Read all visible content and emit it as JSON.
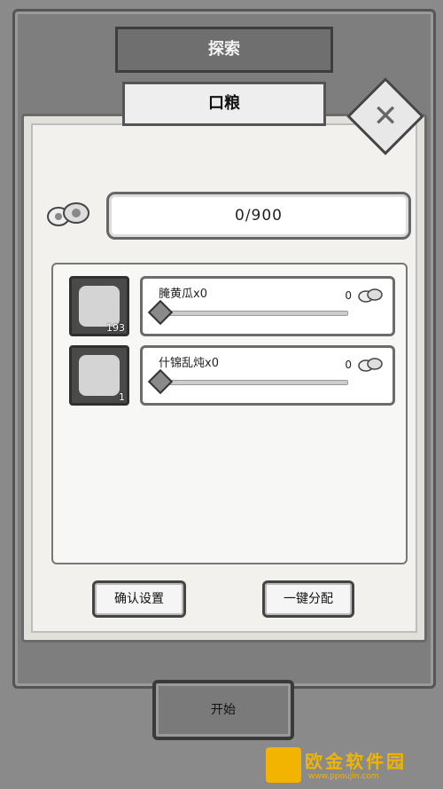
{
  "header": {
    "title": "探索",
    "subtitle": "口粮",
    "close_glyph": "✕"
  },
  "rations": {
    "icon": "rations-icon",
    "total_display": "0/900"
  },
  "items": [
    {
      "name": "腌黄瓜x0",
      "count": "193",
      "value": "0",
      "icon": "pickle-jar-icon",
      "slider_level": 0
    },
    {
      "name": "什锦乱炖x0",
      "count": "1",
      "value": "0",
      "icon": "stew-bowl-icon",
      "slider_level": 0
    }
  ],
  "buttons": {
    "confirm": "确认设置",
    "auto": "一键分配",
    "start": "开始"
  },
  "watermark": {
    "text": "欧金软件园",
    "url": "www.ppoujin.com"
  },
  "colors": {
    "watermark": "#f2b400"
  }
}
